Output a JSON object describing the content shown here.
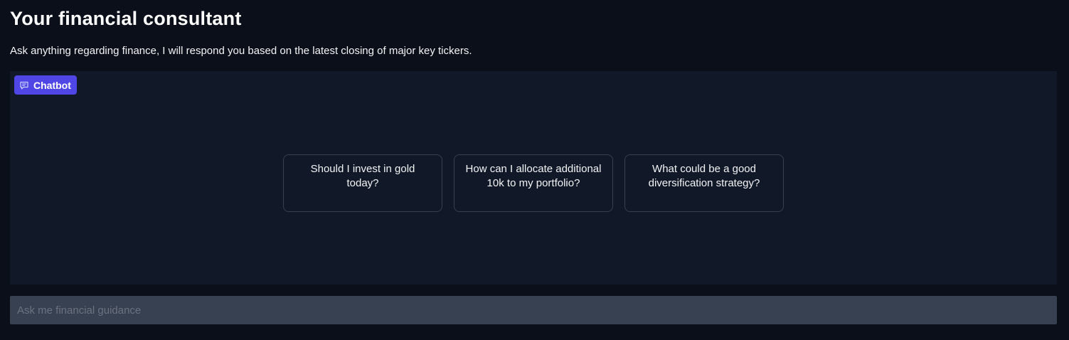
{
  "header": {
    "title": "Your financial consultant",
    "subtitle": "Ask anything regarding finance, I will respond you based on the latest closing of major key tickers."
  },
  "chatbot": {
    "label": "Chatbot",
    "icon": "chat-icon",
    "accent_color": "#4f46e5",
    "examples": [
      "Should I invest in gold today?",
      "How can I allocate additional 10k to my portfolio?",
      "What could be a good diversification strategy?"
    ]
  },
  "input": {
    "placeholder": "Ask me financial guidance",
    "value": ""
  }
}
